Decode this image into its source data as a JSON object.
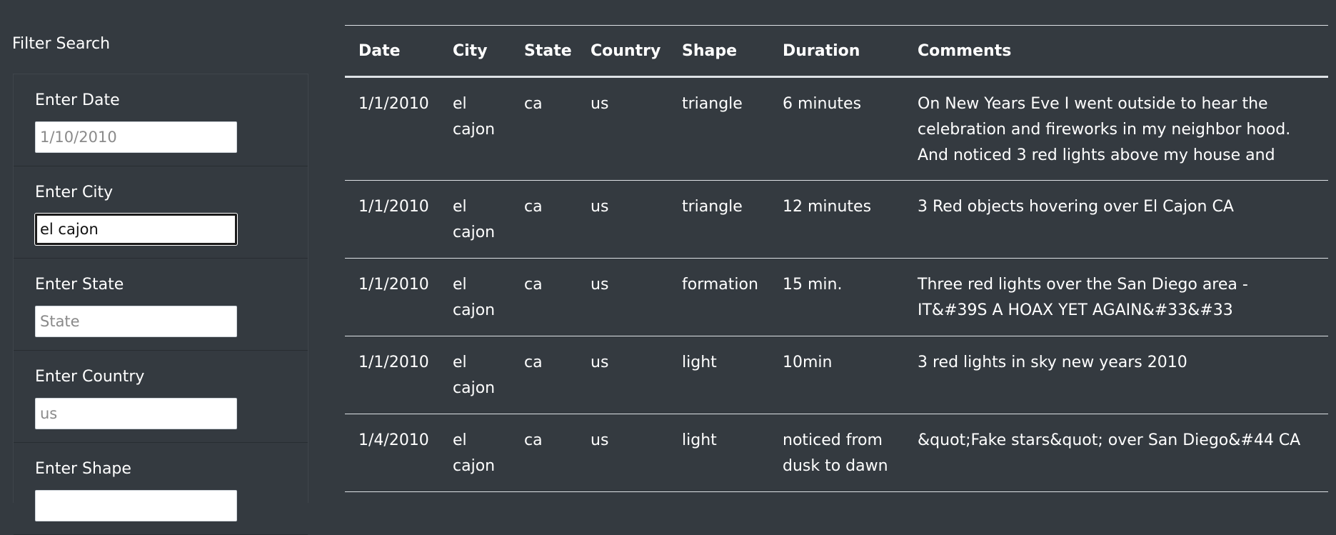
{
  "sidebar": {
    "title": "Filter Search",
    "filters": [
      {
        "label": "Enter Date",
        "value": "",
        "placeholder": "1/10/2010"
      },
      {
        "label": "Enter City",
        "value": "el cajon",
        "placeholder": ""
      },
      {
        "label": "Enter State",
        "value": "",
        "placeholder": "State"
      },
      {
        "label": "Enter Country",
        "value": "",
        "placeholder": "us"
      },
      {
        "label": "Enter Shape",
        "value": "",
        "placeholder": ""
      }
    ]
  },
  "table": {
    "headers": [
      "Date",
      "City",
      "State",
      "Country",
      "Shape",
      "Duration",
      "Comments"
    ],
    "rows": [
      [
        "1/1/2010",
        "el cajon",
        "ca",
        "us",
        "triangle",
        "6 minutes",
        "On New Years Eve I went outside to hear the celebration and fireworks in my neighbor hood. And noticed 3 red lights above my house and"
      ],
      [
        "1/1/2010",
        "el cajon",
        "ca",
        "us",
        "triangle",
        "12 minutes",
        "3 Red objects hovering over El Cajon CA"
      ],
      [
        "1/1/2010",
        "el cajon",
        "ca",
        "us",
        "formation",
        "15 min.",
        "Three red lights over the San Diego area - IT&#39S A HOAX YET AGAIN&#33&#33"
      ],
      [
        "1/1/2010",
        "el cajon",
        "ca",
        "us",
        "light",
        "10min",
        "3 red lights in sky new years 2010"
      ],
      [
        "1/4/2010",
        "el cajon",
        "ca",
        "us",
        "light",
        "noticed from dusk to dawn",
        "&quot;Fake stars&quot; over San Diego&#44 CA"
      ]
    ]
  }
}
